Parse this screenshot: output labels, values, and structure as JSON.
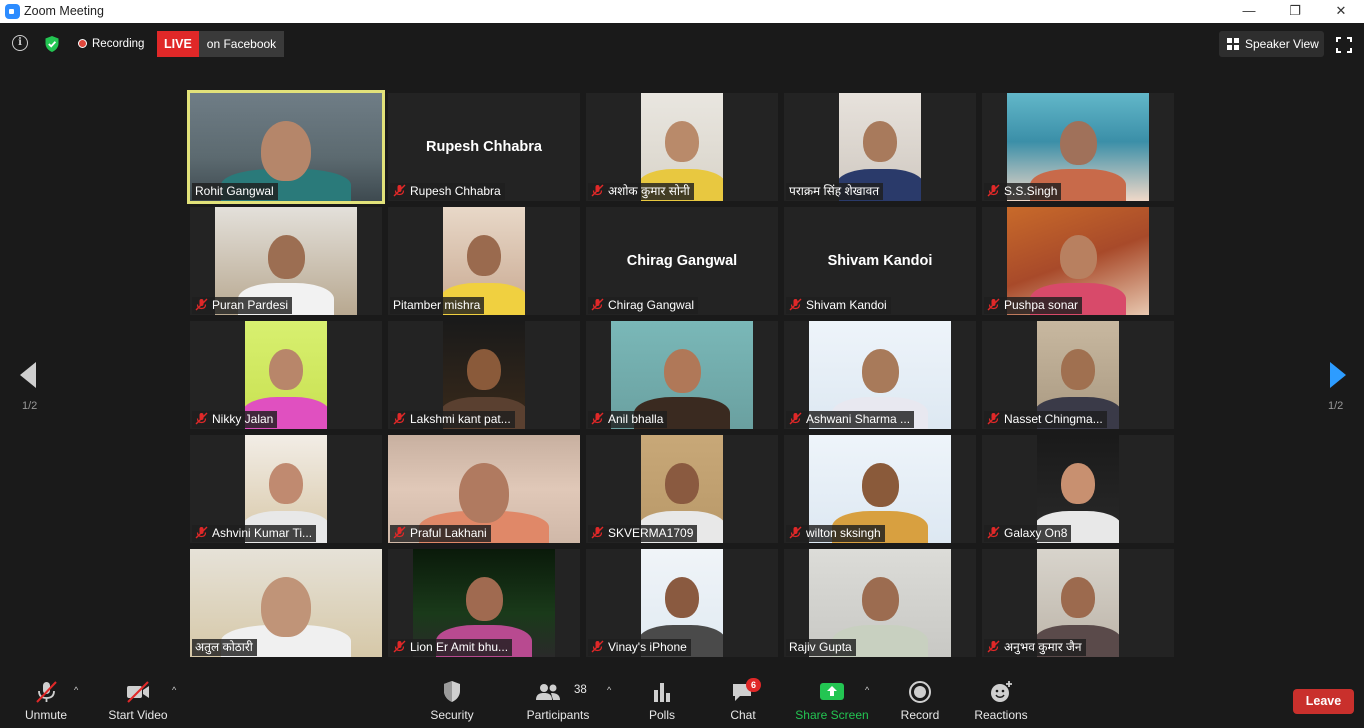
{
  "window": {
    "title": "Zoom Meeting",
    "minimize": "—",
    "maximize": "❐",
    "close": "✕"
  },
  "topbar": {
    "recording_label": "Recording",
    "live_label": "LIVE",
    "live_destination": "on Facebook",
    "view_label": "Speaker View"
  },
  "pagination": {
    "left": "1/2",
    "right": "1/2"
  },
  "participants": [
    {
      "name": "Rohit Gangwal",
      "muted": false,
      "video": true,
      "active": true
    },
    {
      "name": "Rupesh Chhabra",
      "muted": true,
      "video": false
    },
    {
      "name": "अशोक कुमार सोनी",
      "muted": true,
      "video": true
    },
    {
      "name": "पराक्रम सिंह शेखावत",
      "muted": false,
      "video": true
    },
    {
      "name": "S.S.Singh",
      "muted": true,
      "video": true
    },
    {
      "name": "Puran Pardesi",
      "muted": true,
      "video": true
    },
    {
      "name": "Pitamber mishra",
      "muted": false,
      "video": true
    },
    {
      "name": "Chirag Gangwal",
      "muted": true,
      "video": false
    },
    {
      "name": "Shivam Kandoi",
      "muted": true,
      "video": false
    },
    {
      "name": "Pushpa sonar",
      "muted": true,
      "video": true
    },
    {
      "name": "Nikky Jalan",
      "muted": true,
      "video": true
    },
    {
      "name": "Lakshmi kant pat...",
      "muted": true,
      "video": true
    },
    {
      "name": "Anil bhalla",
      "muted": true,
      "video": true
    },
    {
      "name": "Ashwani Sharma ...",
      "muted": true,
      "video": true
    },
    {
      "name": "Nasset Chingma...",
      "muted": true,
      "video": true
    },
    {
      "name": "Ashvini Kumar Ti...",
      "muted": true,
      "video": true
    },
    {
      "name": "Praful Lakhani",
      "muted": true,
      "video": true
    },
    {
      "name": "SKVERMA1709",
      "muted": true,
      "video": true
    },
    {
      "name": "wilton sksingh",
      "muted": true,
      "video": true
    },
    {
      "name": "Galaxy On8",
      "muted": true,
      "video": true
    },
    {
      "name": "अतुल कोठारी",
      "muted": false,
      "video": true
    },
    {
      "name": "Lion Er Amit bhu...",
      "muted": true,
      "video": true
    },
    {
      "name": "Vinay's iPhone",
      "muted": true,
      "video": true
    },
    {
      "name": "Rajiv Gupta",
      "muted": false,
      "video": true
    },
    {
      "name": "अनुभव कुमार जैन",
      "muted": true,
      "video": true
    }
  ],
  "toolbar": {
    "unmute": "Unmute",
    "start_video": "Start Video",
    "security": "Security",
    "participants": "Participants",
    "participants_count": "38",
    "polls": "Polls",
    "chat": "Chat",
    "chat_badge": "6",
    "share_screen": "Share Screen",
    "record": "Record",
    "reactions": "Reactions",
    "leave": "Leave"
  },
  "colors": {
    "active_speaker": "#e2e27a",
    "live": "#e02828",
    "share": "#23c552",
    "leave": "#c9302c",
    "next_arrow": "#2d9cff"
  }
}
